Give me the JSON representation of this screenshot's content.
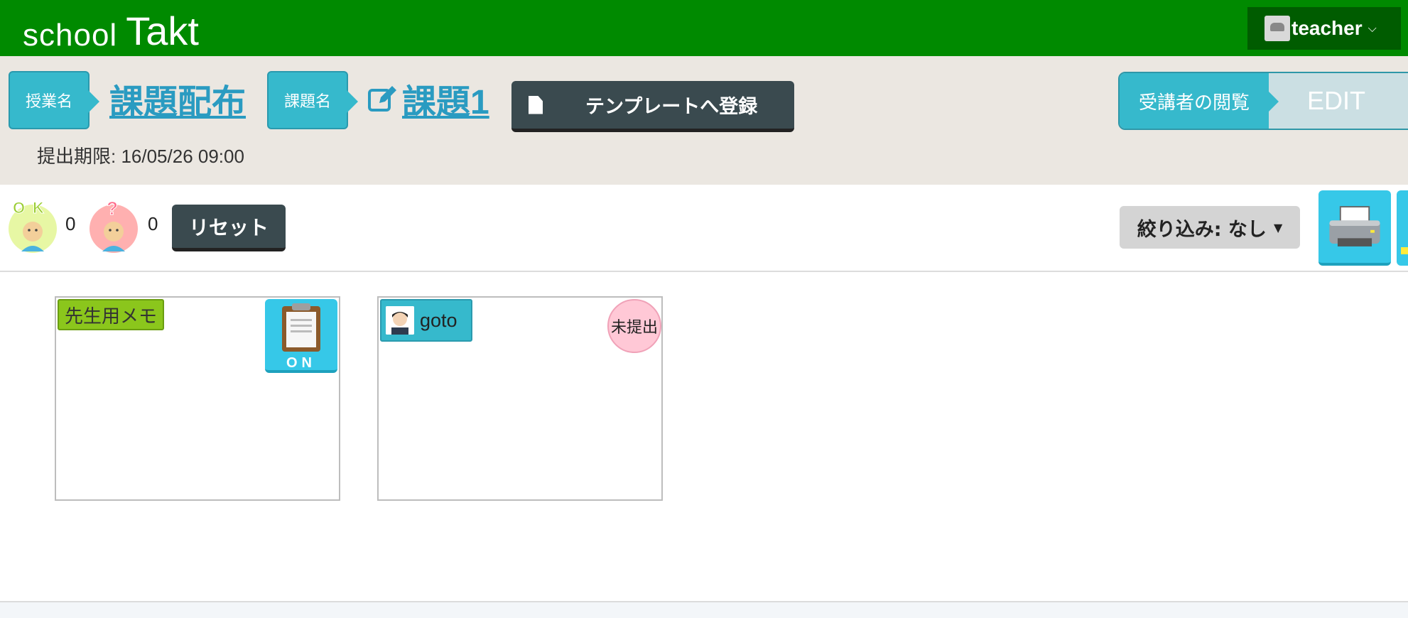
{
  "header": {
    "logo_school": "school",
    "logo_takt": "Takt",
    "user": {
      "name": "teacher",
      "avatar_icon": "user-avatar-icon",
      "menu_icon": "chevron-down-icon"
    },
    "bg_color": "#008a00"
  },
  "lesson": {
    "lesson_tag": "授業名",
    "lesson_title": "課題配布",
    "task_tag": "課題名",
    "task_title": "課題1",
    "template_button": "テンプレートへ登録",
    "deadline": "提出期限: 16/05/26 09:00",
    "viewer_label": "受講者の閲覧",
    "viewer_mode": "EDIT"
  },
  "toolbar": {
    "ok_count": "0",
    "question_count": "0",
    "reset_button": "リセット",
    "filter_button": "絞り込み: なし",
    "print_icon": "printer-icon"
  },
  "cards": {
    "memo": {
      "label": "先生用メモ",
      "toggle_label": "ON",
      "icon": "clipboard-icon"
    },
    "student": {
      "name": "goto",
      "status": "未提出"
    }
  },
  "colors": {
    "accent": "#36b9cc",
    "dark_button": "#3a4a4f",
    "memo_tag": "#8bc61c",
    "unsubmitted": "#ffc8d6"
  }
}
